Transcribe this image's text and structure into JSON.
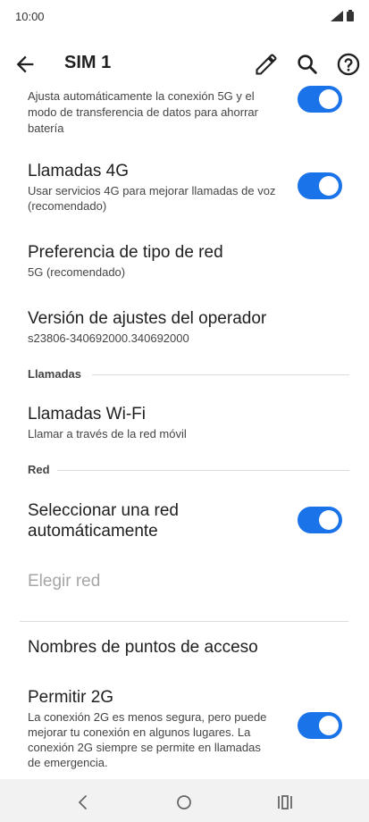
{
  "status_bar": {
    "time": "10:00",
    "icons": [
      "signal-icon",
      "battery-icon"
    ]
  },
  "app_bar": {
    "title": "SIM 1",
    "icons": [
      "back-arrow-icon",
      "edit-pencil-icon",
      "search-icon",
      "help-icon"
    ]
  },
  "items": {
    "auto5g": {
      "subtitle_line1": "Ajusta automáticamente la conexión 5G y el",
      "subtitle_line2": "modo de transferencia de datos para ahorrar",
      "subtitle_line3": "batería",
      "enabled": true
    },
    "calls4g": {
      "title": "Llamadas 4G",
      "subtitle_line1": "Usar servicios 4G para mejorar llamadas de voz",
      "subtitle_line2": "(recomendado)",
      "enabled": true
    },
    "network_pref": {
      "title": "Preferencia de tipo de red",
      "subtitle": "5G (recomendado)"
    },
    "carrier_version": {
      "title": "Versión de ajustes del operador",
      "subtitle": "s23806-340692000.340692000"
    },
    "section_calls": "Llamadas",
    "wifi_calls": {
      "title": "Llamadas Wi-Fi",
      "subtitle": "Llamar a través de la red móvil"
    },
    "section_network": "Red",
    "auto_network": {
      "title_line1": "Seleccionar una red",
      "title_line2": "automáticamente",
      "enabled": true
    },
    "choose_network": {
      "title": "Elegir red",
      "disabled": true
    },
    "apn": {
      "title": "Nombres de puntos de acceso"
    },
    "allow2g": {
      "title": "Permitir 2G",
      "subtitle_line1": "La conexión 2G es menos segura, pero puede",
      "subtitle_line2": "mejorar tu conexión en algunos lugares. La",
      "subtitle_line3": "conexión 2G siempre se permite en llamadas",
      "subtitle_line4": "de emergencia.",
      "enabled": true
    }
  },
  "colors": {
    "accent": "#1a73e8",
    "disabled_text": "#a6a6a6",
    "divider": "#dcdcdc"
  },
  "nav_bar": {
    "icons": [
      "nav-back-icon",
      "nav-home-icon",
      "nav-recents-icon"
    ]
  }
}
